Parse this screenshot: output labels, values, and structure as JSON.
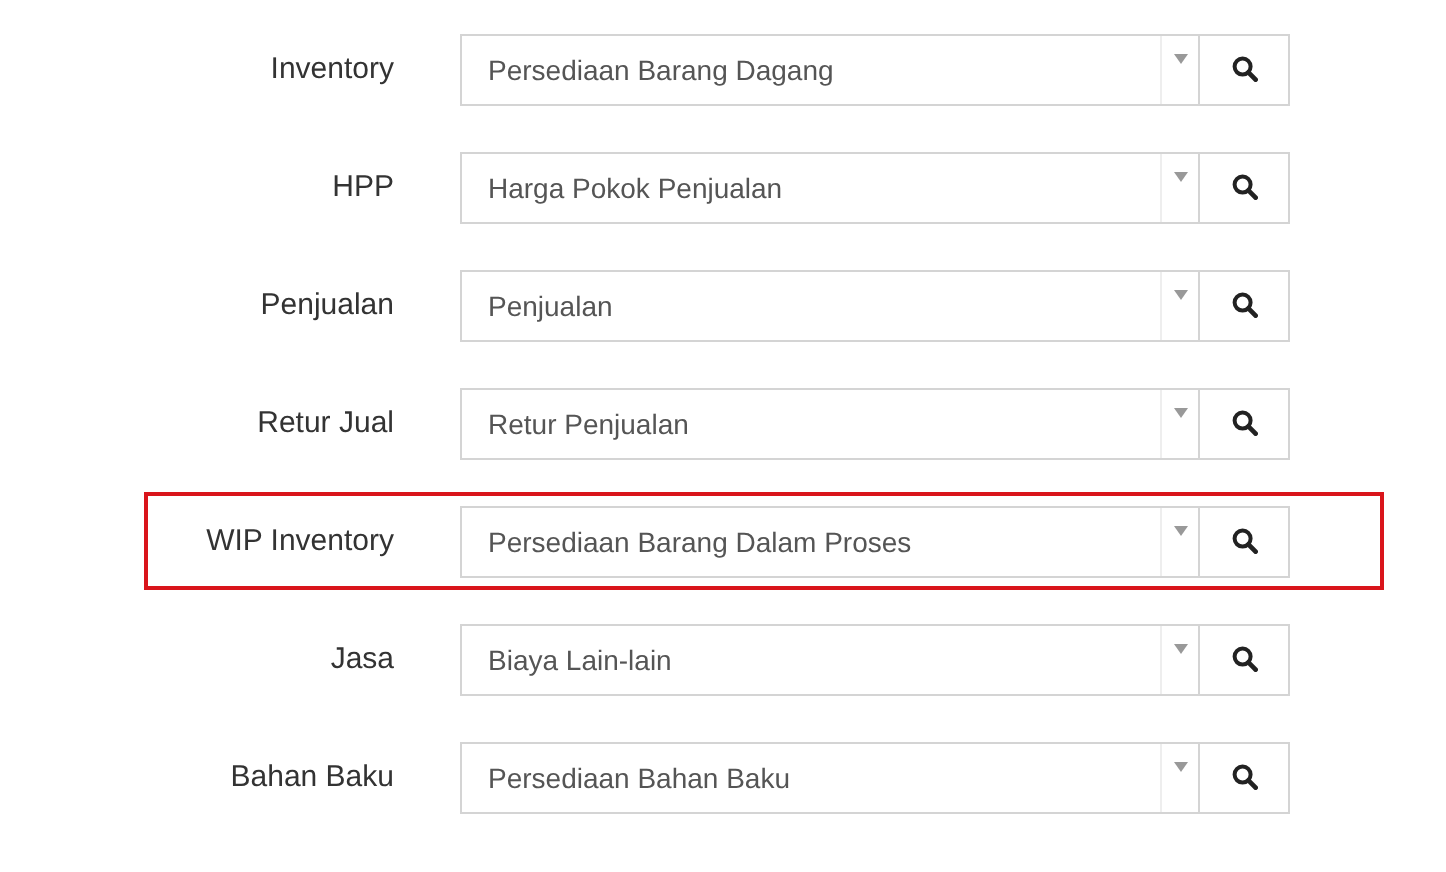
{
  "rows": [
    {
      "label": "Inventory",
      "value": "Persediaan Barang Dagang",
      "highlighted": false
    },
    {
      "label": "HPP",
      "value": "Harga Pokok Penjualan",
      "highlighted": false
    },
    {
      "label": "Penjualan",
      "value": "Penjualan",
      "highlighted": false
    },
    {
      "label": "Retur Jual",
      "value": "Retur Penjualan",
      "highlighted": false
    },
    {
      "label": "WIP Inventory",
      "value": "Persediaan Barang Dalam Proses",
      "highlighted": true
    },
    {
      "label": "Jasa",
      "value": "Biaya Lain-lain",
      "highlighted": false
    },
    {
      "label": "Bahan Baku",
      "value": "Persediaan Bahan Baku",
      "highlighted": false
    }
  ]
}
